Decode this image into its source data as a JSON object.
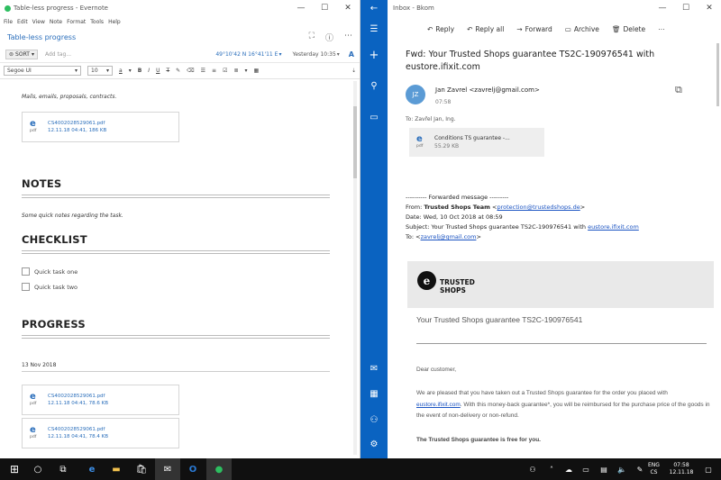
{
  "evernote": {
    "window_title": "Table-less progress - Evernote",
    "menu": [
      "File",
      "Edit",
      "View",
      "Note",
      "Format",
      "Tools",
      "Help"
    ],
    "note_title": "Table-less progress",
    "sort_label": "SORT",
    "add_tag_placeholder": "Add tag...",
    "coordinates": "49°10'42 N  16°41'11 E",
    "modified": "Yesterday 10:35",
    "font_name": "Segoe UI",
    "font_size": "10",
    "intro_text": "Mails, emails, proposals, contracts.",
    "attachments": [
      {
        "name": "CS4002028529061.pdf",
        "meta": "12.11.18 04:41, 186 KB",
        "type": "pdf"
      },
      {
        "name": "CS4002028529061.pdf",
        "meta": "12.11.18 04:41, 78.6 KB",
        "type": "pdf"
      },
      {
        "name": "CS4002028529061.pdf",
        "meta": "12.11.18 04:41, 78.4 KB",
        "type": "pdf"
      }
    ],
    "notes_heading": "NOTES",
    "notes_text": "Some quick notes regarding the task.",
    "checklist_heading": "CHECKLIST",
    "checklist": [
      "Quick task one",
      "Quick task two"
    ],
    "progress_heading": "PROGRESS",
    "progress_date": "13 Nov 2018"
  },
  "mail": {
    "window_title": "Inbox - Bkom",
    "toolbar": {
      "reply": "Reply",
      "reply_all": "Reply all",
      "forward": "Forward",
      "archive": "Archive",
      "delete": "Delete"
    },
    "subject": "Fwd: Your Trusted Shops guarantee TS2C-190976541 with eustore.ifixit.com",
    "sender_initials": "JZ",
    "sender": "Jan Zavrel <zavrelj@gmail.com>",
    "time": "07:58",
    "to": "To: Zavřel Jan, Ing.",
    "attachment_name": "Conditions TS guarantee -...",
    "attachment_size": "55.29 KB",
    "attachment_type": "pdf",
    "fwd_header": "---------- Forwarded message ---------",
    "fwd_from_label": "From:",
    "fwd_from_name": "Trusted Shops Team",
    "fwd_from_email": "protection@trustedshops.de",
    "fwd_date": "Date: Wed, 10 Oct 2018 at 08:59",
    "fwd_subject_prefix": "Subject: Your Trusted Shops guarantee TS2C-190976541 with",
    "fwd_subject_link": "eustore.ifixit.com",
    "fwd_to_label": "To:",
    "fwd_to_email": "zavrelj@gmail.com",
    "ts_logo_line1": "TRUSTED",
    "ts_logo_line2": "SHOPS",
    "ts_title": "Your Trusted Shops guarantee TS2C-190976541",
    "ts_greeting": "Dear customer,",
    "ts_para1_a": "We are pleased that you have taken out a Trusted Shops guarantee for the order you placed with",
    "ts_para1_link": "eustore.ifixit.com",
    "ts_para1_b": ". With this money-back guarantee*, you will be reimbursed for the purchase price of the goods in the event of non-delivery or non-refund.",
    "ts_bold": "The Trusted Shops guarantee is free for you."
  },
  "taskbar": {
    "lang": "ENG",
    "lang_sub": "CS",
    "time": "07:58",
    "date": "12.11.18"
  },
  "colors": {
    "mail_sidebar": "#0a63c1",
    "evernote_link": "#2a6ebb",
    "taskbar": "#101010"
  }
}
